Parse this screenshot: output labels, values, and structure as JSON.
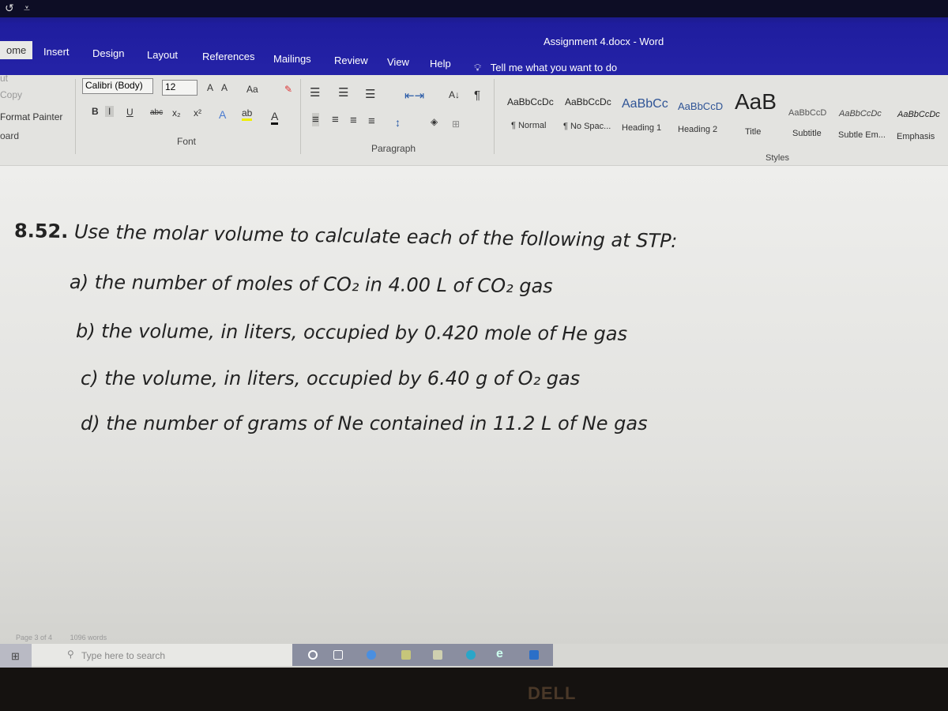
{
  "window": {
    "title": "Assignment 4.docx  -  Word",
    "qat_undo": "↺",
    "qat_more": "⩡"
  },
  "tabs": [
    {
      "label": "ome"
    },
    {
      "label": "Insert"
    },
    {
      "label": "Design"
    },
    {
      "label": "Layout"
    },
    {
      "label": "References"
    },
    {
      "label": "Mailings"
    },
    {
      "label": "Review"
    },
    {
      "label": "View"
    },
    {
      "label": "Help"
    }
  ],
  "tell_me": "Tell me what you want to do",
  "clipboard": {
    "cut": "ut",
    "copy": "Copy",
    "format_painter": "Format Painter",
    "label": "oard"
  },
  "font": {
    "name": "Calibri (Body)",
    "size": "12",
    "grow": "A",
    "shrink": "A",
    "case": "Aa",
    "bold": "B",
    "italic": "I",
    "underline": "U",
    "strike": "abc",
    "sub": "x₂",
    "sup": "x²",
    "effects": "A",
    "highlight": "ab",
    "color": "A",
    "label": "Font"
  },
  "paragraph": {
    "label": "Paragraph",
    "sort": "A↓",
    "pilcrow": "¶"
  },
  "styles": {
    "label": "Styles",
    "items": [
      {
        "sample": "AaBbCcDc",
        "name": "¶ Normal"
      },
      {
        "sample": "AaBbCcDc",
        "name": "¶ No Spac..."
      },
      {
        "sample": "AaBbCc",
        "name": "Heading 1"
      },
      {
        "sample": "AaBbCcD",
        "name": "Heading 2"
      },
      {
        "sample": "AaB",
        "name": "Title"
      },
      {
        "sample": "AaBbCcD",
        "name": "Subtitle"
      },
      {
        "sample": "AaBbCcDc",
        "name": "Subtle Em..."
      },
      {
        "sample": "AaBbCcDc",
        "name": "Emphasis"
      }
    ]
  },
  "document": {
    "heading_num": "8.52.",
    "heading_text": "Use the molar volume to calculate each of the following at STP:",
    "items": [
      "a) the number of moles of CO₂ in 4.00 L of CO₂ gas",
      "b) the volume, in liters, occupied by 0.420 mole of He gas",
      "c) the volume, in liters, occupied by 6.40 g of O₂ gas",
      "d) the number of grams of Ne contained in 11.2 L of Ne gas"
    ]
  },
  "status": {
    "page": "Page 3 of 4",
    "words": "1096 words"
  },
  "taskbar": {
    "search_placeholder": "Type here to search"
  },
  "bezel_logo": "DELL"
}
